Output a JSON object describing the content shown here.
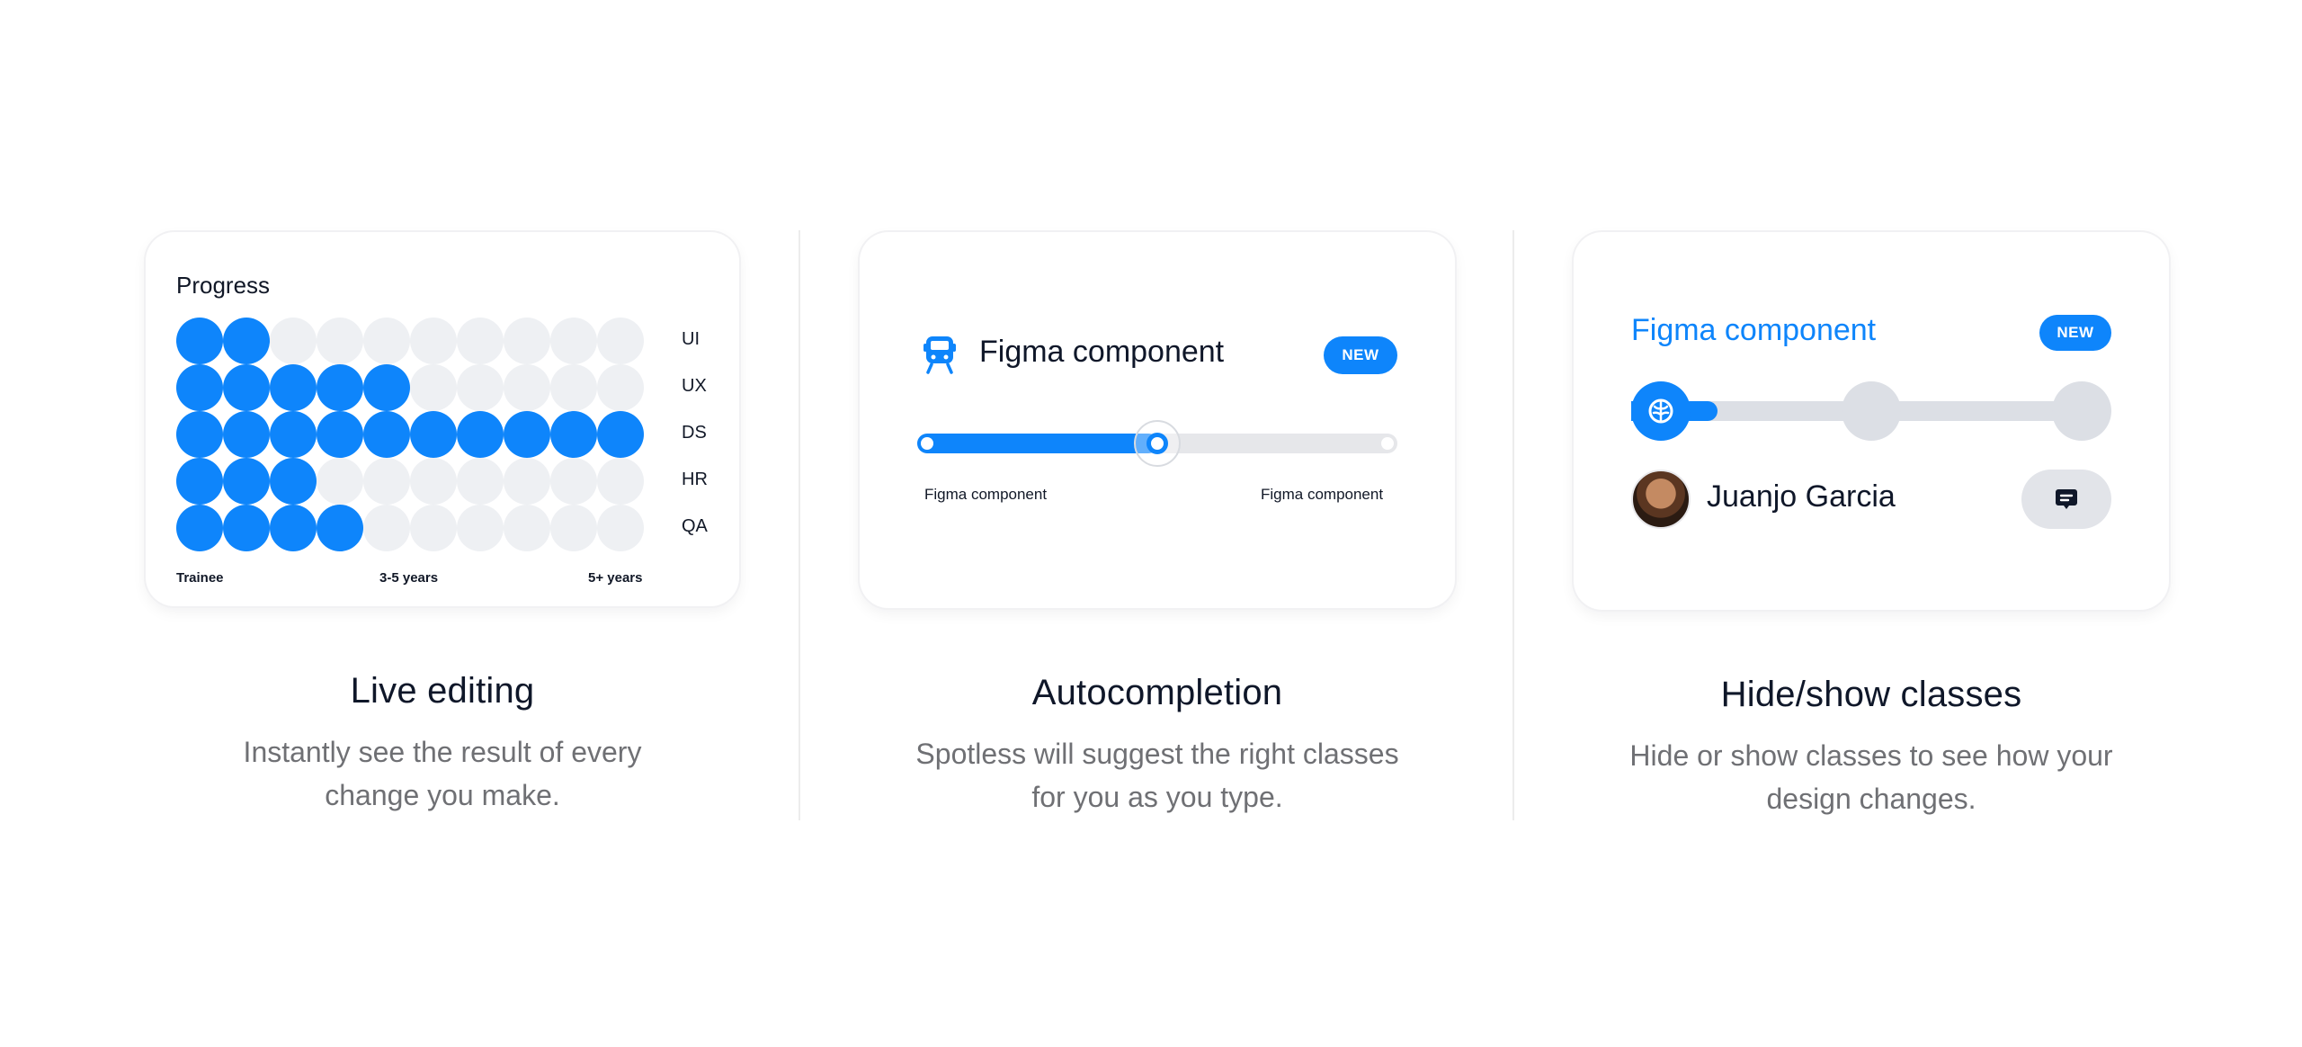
{
  "colors": {
    "accent": "#0e85fb",
    "inactive": "#eef0f3",
    "text": "#0f1729",
    "muted": "#6f7074"
  },
  "progress_card": {
    "title": "Progress",
    "rows": [
      {
        "label": "UI",
        "filled": 2
      },
      {
        "label": "UX",
        "filled": 5
      },
      {
        "label": "DS",
        "filled": 10
      },
      {
        "label": "HR",
        "filled": 3
      },
      {
        "label": "QA",
        "filled": 4
      }
    ],
    "total_per_row": 10,
    "axis": {
      "start": "Trainee",
      "middle": "3-5 years",
      "end": "5+ years"
    }
  },
  "slider_card": {
    "icon": "train-icon",
    "title": "Figma component",
    "badge": "NEW",
    "slider_value": 0.48,
    "left_caption": "Figma component",
    "right_caption": "Figma component"
  },
  "stepper_card": {
    "title": "Figma component",
    "badge": "NEW",
    "progress": 0.18,
    "user_name": "Juanjo Garcia",
    "chat_icon": "chat-bubble-icon",
    "step_icon": "brain-icon"
  },
  "features": [
    {
      "title": "Live editing",
      "desc_line1": "Instantly see the result of every",
      "desc_line2": "change you make."
    },
    {
      "title": "Autocompletion",
      "desc_line1": "Spotless will suggest the right classes",
      "desc_line2": "for you as you type."
    },
    {
      "title": "Hide/show classes",
      "desc_line1": "Hide or show classes to see how your",
      "desc_line2": "design changes."
    }
  ]
}
